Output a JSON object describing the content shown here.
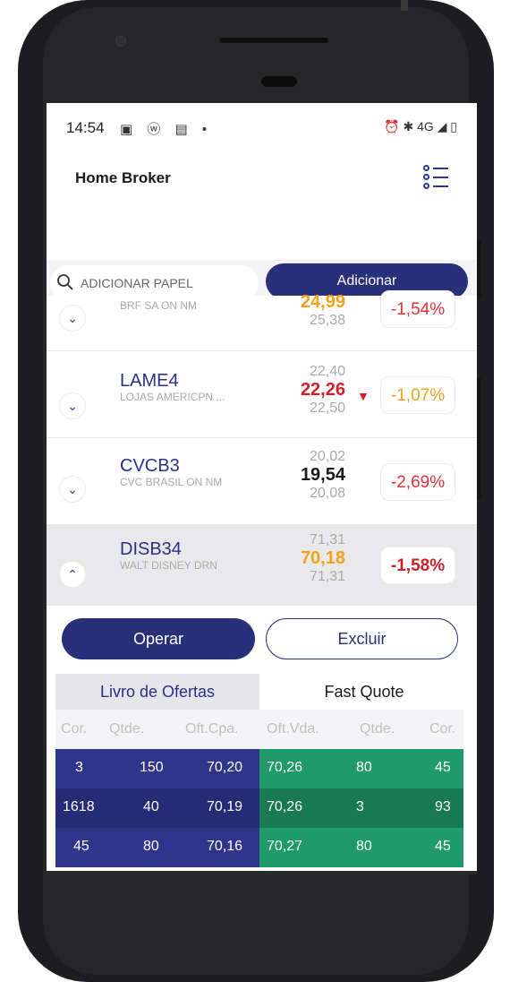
{
  "status_bar": {
    "time": "14:54",
    "left_icons": "▣ ⓦ ▤ •",
    "right_icons": "⏰ ✱ 4G ◢ ▯"
  },
  "app": {
    "title": "Home Broker"
  },
  "search": {
    "placeholder": "ADICIONAR PAPEL",
    "add_label": "Adicionar"
  },
  "quotes": [
    {
      "ticker": "",
      "company": "BRF SA ON NM",
      "prices": [
        "",
        "24,99",
        "25,38"
      ],
      "main_color": "#f2a11b",
      "variation": "-1,54%",
      "variation_color": "#e0323c",
      "expanded": false,
      "arrow": ""
    },
    {
      "ticker": "LAME4",
      "company": "LOJAS AMERICPN ...",
      "prices": [
        "22,40",
        "22,26",
        "22,50"
      ],
      "main_color": "#d0202a",
      "variation": "-1,07%",
      "variation_color": "#f2a11b",
      "expanded": false,
      "arrow": "▼"
    },
    {
      "ticker": "CVCB3",
      "company": "CVC BRASIL ON NM",
      "prices": [
        "20,02",
        "19,54",
        "20,08"
      ],
      "main_color": "#1a1a1a",
      "variation": "-2,69%",
      "variation_color": "#e0323c",
      "expanded": false,
      "arrow": ""
    },
    {
      "ticker": "DISB34",
      "company": "WALT DISNEY DRN",
      "prices": [
        "71,31",
        "70,18",
        "71,31"
      ],
      "main_color": "#f2a11b",
      "variation": "-1,58%",
      "variation_color": "#d0202a",
      "expanded": true,
      "arrow": ""
    }
  ],
  "actions": {
    "operate": "Operar",
    "delete": "Excluir"
  },
  "tabs": {
    "book": "Livro de Ofertas",
    "fast_quote": "Fast Quote"
  },
  "order_book": {
    "headers": [
      "Cor.",
      "Qtde.",
      "Oft.Cpa.",
      "Oft.Vda.",
      "Qtde.",
      "Cor."
    ],
    "rows": [
      [
        "3",
        "150",
        "70,20",
        "70,26",
        "80",
        "45"
      ],
      [
        "1618",
        "40",
        "70,19",
        "70,26",
        "3",
        "93"
      ],
      [
        "45",
        "80",
        "70,16",
        "70,27",
        "80",
        "45"
      ]
    ],
    "colors": {
      "buy": [
        "#2e358a",
        "#252c75",
        "#2e358a"
      ],
      "sell": [
        "#1f9a6a",
        "#177a53",
        "#1f9a6a"
      ]
    }
  },
  "colors": {
    "primary": "#28307a",
    "ticker": "#2b2f8a"
  }
}
